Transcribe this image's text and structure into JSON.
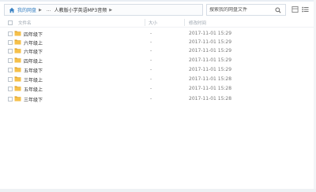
{
  "breadcrumb": {
    "root": "我的网盘",
    "ellipsis": "...",
    "current": "人教版小学英语MP3音频"
  },
  "search": {
    "placeholder": "搜索我的网盘文件"
  },
  "columns": {
    "name": "文件名",
    "size": "大小",
    "modified": "修改时间"
  },
  "files": [
    {
      "name": "四年级下",
      "size": "-",
      "modified": "2017-11-01 15:29"
    },
    {
      "name": "六年级上",
      "size": "-",
      "modified": "2017-11-01 15:29"
    },
    {
      "name": "六年级下",
      "size": "-",
      "modified": "2017-11-01 15:29"
    },
    {
      "name": "四年级上",
      "size": "-",
      "modified": "2017-11-01 15:29"
    },
    {
      "name": "五年级下",
      "size": "-",
      "modified": "2017-11-01 15:29"
    },
    {
      "name": "三年级上",
      "size": "-",
      "modified": "2017-11-01 15:28"
    },
    {
      "name": "五年级上",
      "size": "-",
      "modified": "2017-11-01 15:28"
    },
    {
      "name": "三年级下",
      "size": "-",
      "modified": "2017-11-01 15:28"
    }
  ],
  "colors": {
    "link": "#3b83c4",
    "folder": "#f5c04a",
    "folder_dark": "#e0a52d"
  },
  "icons": [
    "home-icon",
    "search-icon",
    "grid-view-icon",
    "list-view-icon",
    "folder-icon"
  ]
}
